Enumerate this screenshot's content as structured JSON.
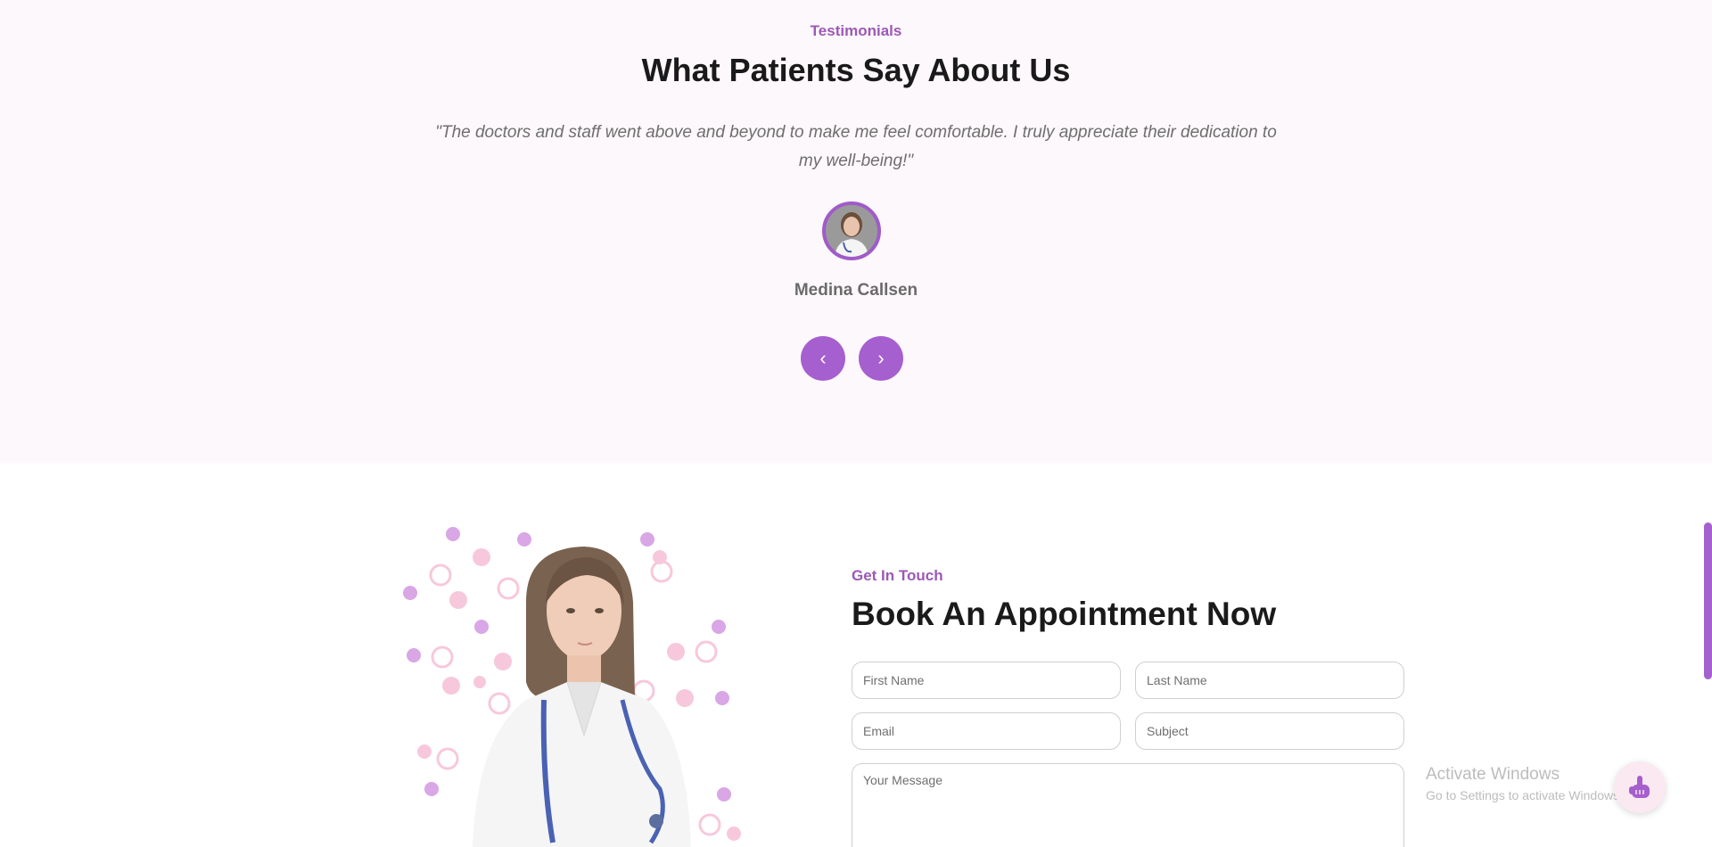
{
  "testimonials": {
    "eyebrow": "Testimonials",
    "title": "What Patients Say About Us",
    "quote": "\"The doctors and staff went above and beyond to make me feel comfortable. I truly appreciate their dedication to my well-being!\"",
    "name": "Medina Callsen",
    "prev_label": "‹",
    "next_label": "›"
  },
  "appointment": {
    "eyebrow": "Get In Touch",
    "title": "Book An Appointment Now",
    "fields": {
      "first_name": "First Name",
      "last_name": "Last Name",
      "email": "Email",
      "subject": "Subject",
      "message": "Your Message"
    }
  },
  "watermark": {
    "line1": "Activate Windows",
    "line2": "Go to Settings to activate Windows."
  },
  "icons": {
    "chat": "hand-pointing-icon"
  },
  "colors": {
    "accent": "#a65fcf",
    "eyebrow": "#9b59b6",
    "section_bg": "#fdf8fb"
  }
}
